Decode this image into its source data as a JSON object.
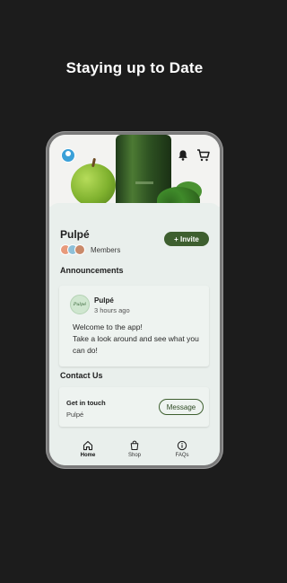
{
  "headline": "Staying up to Date",
  "site": {
    "name": "Pulpé",
    "members_label": "Members",
    "invite_label": "+ Invite"
  },
  "announcements": {
    "title": "Announcements",
    "post": {
      "logo_text": "Pulpé",
      "author": "Pulpé",
      "time": "3 hours ago",
      "body": "Welcome to the app!\nTake a look around and see what you can do!"
    }
  },
  "contact": {
    "title": "Contact Us",
    "label": "Get in touch",
    "sub": "Pulpé",
    "message_label": "Message"
  },
  "nav": {
    "items": [
      {
        "label": "Home",
        "icon": "home-icon",
        "active": true
      },
      {
        "label": "Shop",
        "icon": "bag-icon",
        "active": false
      },
      {
        "label": "FAQs",
        "icon": "info-icon",
        "active": false
      }
    ]
  },
  "colors": {
    "accent": "#3e5f2f",
    "background": "#1c1c1c",
    "screen": "#e9efec"
  }
}
